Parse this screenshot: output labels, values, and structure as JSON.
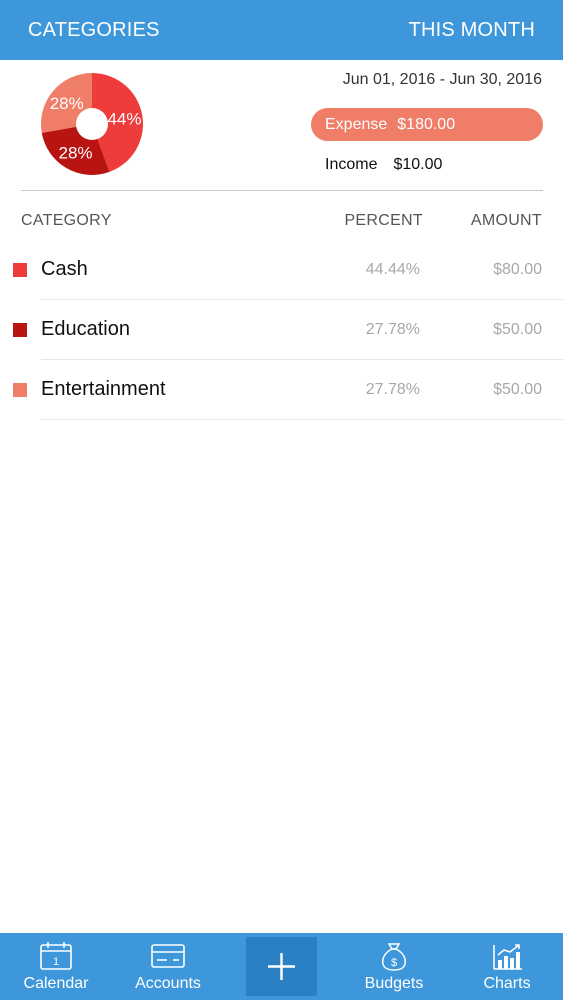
{
  "header": {
    "left_label": "CATEGORIES",
    "right_label": "THIS MONTH",
    "background": "#3d97da"
  },
  "summary": {
    "date_range": "Jun 01, 2016 - Jun 30, 2016",
    "expense_label": "Expense",
    "expense_amount": "$180.00",
    "income_label": "Income",
    "income_amount": "$10.00"
  },
  "chart_data": {
    "type": "pie",
    "donut": true,
    "slices": [
      {
        "label": "Cash",
        "value": 44.44,
        "display": "44%",
        "color": "#ee3b3b"
      },
      {
        "label": "Education",
        "value": 27.78,
        "display": "28%",
        "color": "#b71412"
      },
      {
        "label": "Entertainment",
        "value": 27.78,
        "display": "28%",
        "color": "#ef7d68"
      }
    ]
  },
  "table": {
    "columns": {
      "category": "CATEGORY",
      "percent": "PERCENT",
      "amount": "AMOUNT"
    },
    "rows": [
      {
        "name": "Cash",
        "percent": "44.44%",
        "amount": "$80.00",
        "color": "#ee3b3b"
      },
      {
        "name": "Education",
        "percent": "27.78%",
        "amount": "$50.00",
        "color": "#b71412"
      },
      {
        "name": "Entertainment",
        "percent": "27.78%",
        "amount": "$50.00",
        "color": "#ef7d68"
      }
    ]
  },
  "tabbar": {
    "tabs": [
      {
        "label": "Calendar",
        "icon": "calendar-icon",
        "icon_text": "1"
      },
      {
        "label": "Accounts",
        "icon": "card-icon"
      },
      {
        "label": "",
        "icon": "plus-icon"
      },
      {
        "label": "Budgets",
        "icon": "money-bag-icon",
        "icon_text": "$"
      },
      {
        "label": "Charts",
        "icon": "bar-chart-icon"
      }
    ]
  }
}
